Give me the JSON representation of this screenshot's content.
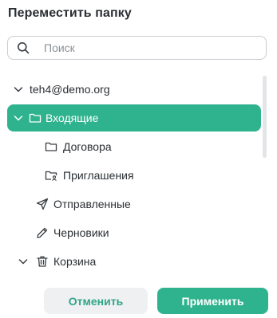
{
  "dialog": {
    "title": "Переместить папку",
    "search": {
      "placeholder": "Поиск",
      "value": ""
    },
    "tree": {
      "account": "teh4@demo.org",
      "folders": {
        "inbox": "Входящие",
        "contracts": "Договора",
        "invitations": "Приглашения",
        "sent": "Отправленные",
        "drafts": "Черновики",
        "trash": "Корзина"
      }
    },
    "buttons": {
      "cancel": "Отменить",
      "apply": "Применить"
    }
  },
  "colors": {
    "accent": "#2fb38e",
    "cancel_bg": "#eef0f2",
    "text": "#2b2f33"
  },
  "icons": [
    "search-icon",
    "chevron-down-icon",
    "folder-icon",
    "folder-shared-icon",
    "send-icon",
    "pencil-icon",
    "trash-icon"
  ]
}
